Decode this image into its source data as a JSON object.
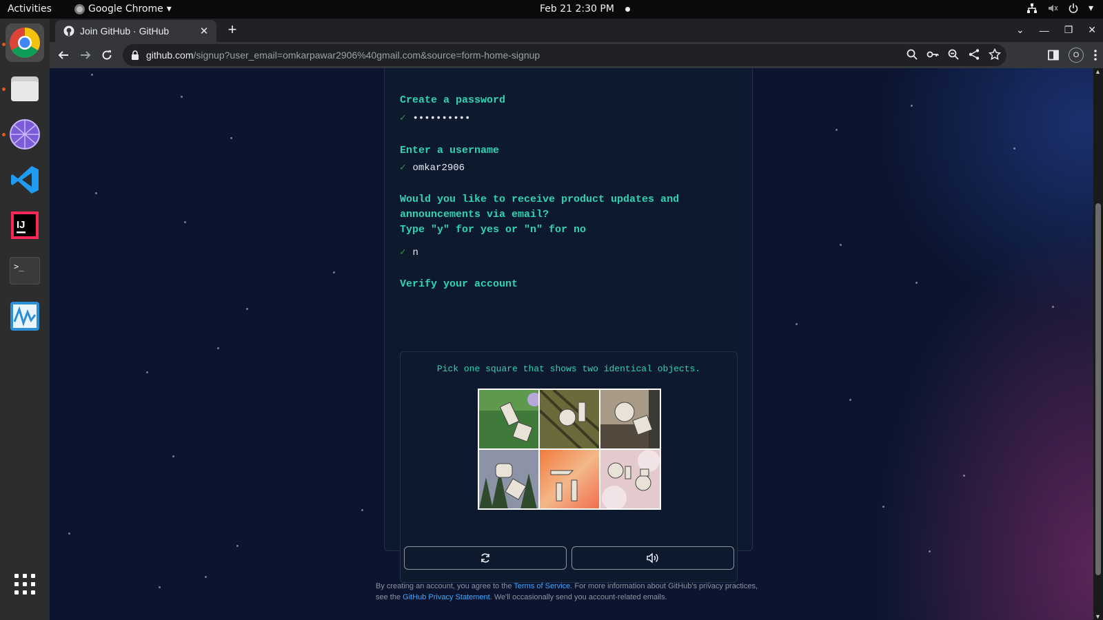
{
  "topbar": {
    "activities": "Activities",
    "app_name": "Google Chrome",
    "clock": "Feb 21  2:30 PM"
  },
  "dock": {
    "apps": [
      "chrome-icon",
      "files-icon",
      "web-browser-icon",
      "vscode-icon",
      "intellij-icon",
      "terminal-icon",
      "monitor-icon",
      "app-grid-icon"
    ]
  },
  "browser": {
    "tab_title": "Join GitHub · GitHub",
    "url_host": "github.com",
    "url_rest": "/signup?user_email=omkarpawar2906%40gmail.com&source=form-home-signup",
    "profile_letter": "O"
  },
  "signup": {
    "password_prompt": "Create a password",
    "password_value": "••••••••••",
    "username_prompt": "Enter a username",
    "username_value": "omkar2906",
    "updates_prompt_1": "Would you like to receive product updates and",
    "updates_prompt_2": "announcements via email?",
    "updates_prompt_3": "Type \"y\" for yes or \"n\" for no",
    "updates_value": "n",
    "verify_prompt": "Verify your account",
    "check_mark": "✓"
  },
  "captcha": {
    "instruction": "Pick one square that shows two identical objects.",
    "tiles": [
      "tile-1",
      "tile-2",
      "tile-3",
      "tile-4",
      "tile-5",
      "tile-6"
    ]
  },
  "footer": {
    "line1_a": "By creating an account, you agree to the ",
    "terms_link": "Terms of Service",
    "line1_b": ". For more information about GitHub's privacy practices,",
    "line2_a": "see the ",
    "privacy_link": "GitHub Privacy Statement",
    "line2_b": ". We'll occasionally send you account-related emails."
  },
  "colors": {
    "accent": "#2ed3b7",
    "check": "#2ea043",
    "page_bg": "#0b1530",
    "link": "#3fa9ff"
  }
}
